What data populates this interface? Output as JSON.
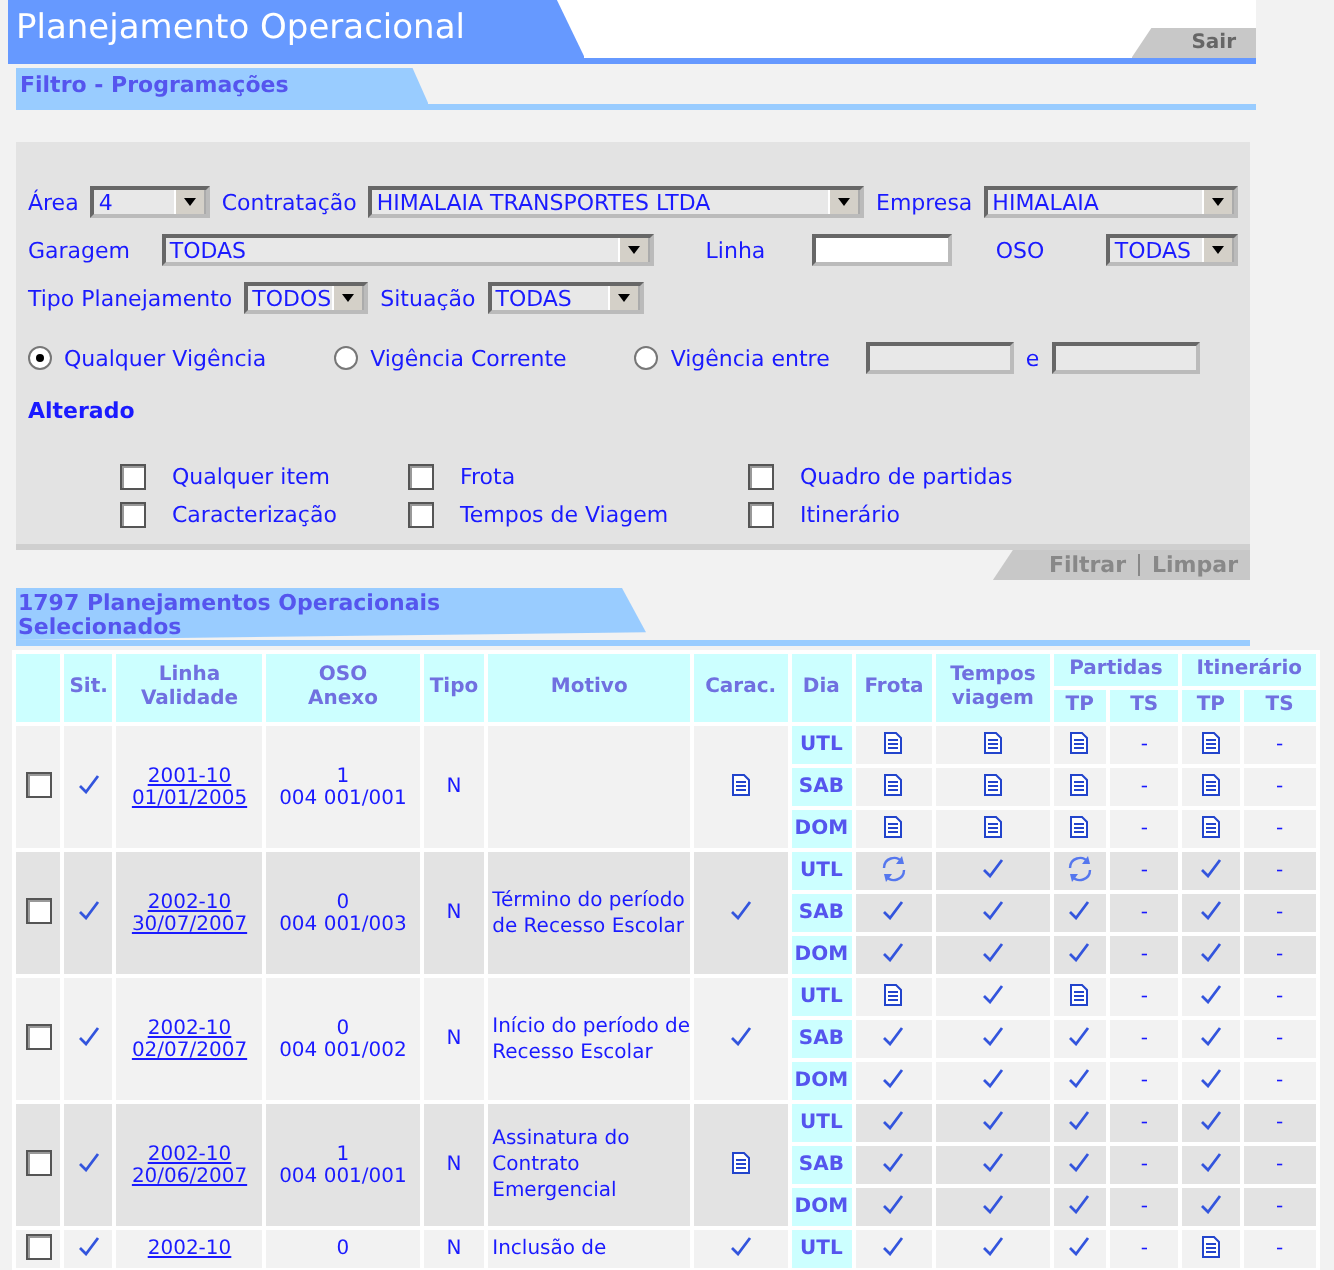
{
  "header": {
    "title": "Planejamento Operacional",
    "exit": "Sair"
  },
  "filter": {
    "title": "Filtro - Programações",
    "area": {
      "label": "Área",
      "value": "4"
    },
    "contratacao": {
      "label": "Contratação",
      "value": "HIMALAIA TRANSPORTES LTDA"
    },
    "empresa": {
      "label": "Empresa",
      "value": "HIMALAIA"
    },
    "garagem": {
      "label": "Garagem",
      "value": "TODAS"
    },
    "linha": {
      "label": "Linha"
    },
    "oso": {
      "label": "OSO",
      "value": "TODAS"
    },
    "tipo": {
      "label": "Tipo Planejamento",
      "value": "TODOS"
    },
    "situacao": {
      "label": "Situação",
      "value": "TODAS"
    },
    "vigencia": [
      {
        "label": "Qualquer Vigência",
        "selected": true
      },
      {
        "label": "Vigência Corrente",
        "selected": false
      },
      {
        "label": "Vigência entre",
        "selected": false
      }
    ],
    "between": "e",
    "alterado": {
      "title": "Alterado",
      "items": [
        {
          "label": "Qualquer item",
          "checked": false
        },
        {
          "label": "Frota",
          "checked": false
        },
        {
          "label": "Quadro de partidas",
          "checked": false
        },
        {
          "label": "Caracterização",
          "checked": false
        },
        {
          "label": "Tempos de Viagem",
          "checked": false
        },
        {
          "label": "Itinerário",
          "checked": false
        }
      ]
    },
    "actions": [
      "Filtrar",
      "Limpar"
    ]
  },
  "results": {
    "title": "1797 Planejamentos Operacionais Selecionados",
    "columns": {
      "sit": "Sit.",
      "linha": [
        "Linha",
        "Validade"
      ],
      "oso": [
        "OSO",
        "Anexo"
      ],
      "tipo": "Tipo",
      "motivo": "Motivo",
      "carac": "Carac.",
      "dia": "Dia",
      "frota": "Frota",
      "tempos": [
        "Tempos",
        "viagem"
      ],
      "partidas": {
        "label": "Partidas",
        "subs": [
          "TP",
          "TS"
        ]
      },
      "itinerario": {
        "label": "Itinerário",
        "subs": [
          "TP",
          "TS"
        ]
      }
    },
    "rows": [
      {
        "checked": false,
        "sit": {
          "kind": "check"
        },
        "linha": "2001-10",
        "validade": "01/01/2005",
        "oso": "1",
        "anexo": "004 001/001",
        "tipo": "N",
        "carac": {
          "kind": "doc"
        },
        "days": [
          {
            "dia": "UTL",
            "cells": [
              {
                "kind": "doc"
              },
              {
                "kind": "doc"
              },
              {
                "kind": "doc"
              },
              {
                "kind": "text",
                "text": "-"
              },
              {
                "kind": "doc"
              },
              {
                "kind": "text",
                "text": "-"
              }
            ]
          },
          {
            "dia": "SAB",
            "cells": [
              {
                "kind": "doc"
              },
              {
                "kind": "doc"
              },
              {
                "kind": "doc"
              },
              {
                "kind": "text",
                "text": "-"
              },
              {
                "kind": "doc"
              },
              {
                "kind": "text",
                "text": "-"
              }
            ]
          },
          {
            "dia": "DOM",
            "cells": [
              {
                "kind": "doc"
              },
              {
                "kind": "doc"
              },
              {
                "kind": "doc"
              },
              {
                "kind": "text",
                "text": "-"
              },
              {
                "kind": "doc"
              },
              {
                "kind": "text",
                "text": "-"
              }
            ]
          }
        ]
      },
      {
        "checked": false,
        "sit": {
          "kind": "check"
        },
        "linha": "2002-10",
        "validade": "30/07/2007",
        "oso": "0",
        "anexo": "004 001/003",
        "tipo": "N",
        "motivo": "Término do período de Recesso Escolar",
        "carac": {
          "kind": "check"
        },
        "days": [
          {
            "dia": "UTL",
            "cells": [
              {
                "kind": "sync"
              },
              {
                "kind": "check"
              },
              {
                "kind": "sync"
              },
              {
                "kind": "text",
                "text": "-"
              },
              {
                "kind": "check"
              },
              {
                "kind": "text",
                "text": "-"
              }
            ]
          },
          {
            "dia": "SAB",
            "cells": [
              {
                "kind": "check"
              },
              {
                "kind": "check"
              },
              {
                "kind": "check"
              },
              {
                "kind": "text",
                "text": "-"
              },
              {
                "kind": "check"
              },
              {
                "kind": "text",
                "text": "-"
              }
            ]
          },
          {
            "dia": "DOM",
            "cells": [
              {
                "kind": "check"
              },
              {
                "kind": "check"
              },
              {
                "kind": "check"
              },
              {
                "kind": "text",
                "text": "-"
              },
              {
                "kind": "check"
              },
              {
                "kind": "text",
                "text": "-"
              }
            ]
          }
        ]
      },
      {
        "checked": false,
        "sit": {
          "kind": "check"
        },
        "linha": "2002-10",
        "validade": "02/07/2007",
        "oso": "0",
        "anexo": "004 001/002",
        "tipo": "N",
        "motivo": "Início do período de Recesso Escolar",
        "carac": {
          "kind": "check"
        },
        "days": [
          {
            "dia": "UTL",
            "cells": [
              {
                "kind": "doc"
              },
              {
                "kind": "check"
              },
              {
                "kind": "doc"
              },
              {
                "kind": "text",
                "text": "-"
              },
              {
                "kind": "check"
              },
              {
                "kind": "text",
                "text": "-"
              }
            ]
          },
          {
            "dia": "SAB",
            "cells": [
              {
                "kind": "check"
              },
              {
                "kind": "check"
              },
              {
                "kind": "check"
              },
              {
                "kind": "text",
                "text": "-"
              },
              {
                "kind": "check"
              },
              {
                "kind": "text",
                "text": "-"
              }
            ]
          },
          {
            "dia": "DOM",
            "cells": [
              {
                "kind": "check"
              },
              {
                "kind": "check"
              },
              {
                "kind": "check"
              },
              {
                "kind": "text",
                "text": "-"
              },
              {
                "kind": "check"
              },
              {
                "kind": "text",
                "text": "-"
              }
            ]
          }
        ]
      },
      {
        "checked": false,
        "sit": {
          "kind": "check"
        },
        "linha": "2002-10",
        "validade": "20/06/2007",
        "oso": "1",
        "anexo": "004 001/001",
        "tipo": "N",
        "motivo": "Assinatura do Contrato Emergencial",
        "carac": {
          "kind": "doc"
        },
        "days": [
          {
            "dia": "UTL",
            "cells": [
              {
                "kind": "check"
              },
              {
                "kind": "check"
              },
              {
                "kind": "check"
              },
              {
                "kind": "text",
                "text": "-"
              },
              {
                "kind": "check"
              },
              {
                "kind": "text",
                "text": "-"
              }
            ]
          },
          {
            "dia": "SAB",
            "cells": [
              {
                "kind": "check"
              },
              {
                "kind": "check"
              },
              {
                "kind": "check"
              },
              {
                "kind": "text",
                "text": "-"
              },
              {
                "kind": "check"
              },
              {
                "kind": "text",
                "text": "-"
              }
            ]
          },
          {
            "dia": "DOM",
            "cells": [
              {
                "kind": "check"
              },
              {
                "kind": "check"
              },
              {
                "kind": "check"
              },
              {
                "kind": "text",
                "text": "-"
              },
              {
                "kind": "check"
              },
              {
                "kind": "text",
                "text": "-"
              }
            ]
          }
        ]
      },
      {
        "checked": false,
        "sit": {
          "kind": "check"
        },
        "linha": "2002-10",
        "oso": "0",
        "tipo": "N",
        "motivo": "Inclusão de",
        "carac": {
          "kind": "check"
        },
        "days": [
          {
            "dia": "UTL",
            "cells": [
              {
                "kind": "check"
              },
              {
                "kind": "check"
              },
              {
                "kind": "check"
              },
              {
                "kind": "text",
                "text": "-"
              },
              {
                "kind": "doc"
              },
              {
                "kind": "text",
                "text": "-"
              }
            ]
          }
        ]
      }
    ]
  }
}
